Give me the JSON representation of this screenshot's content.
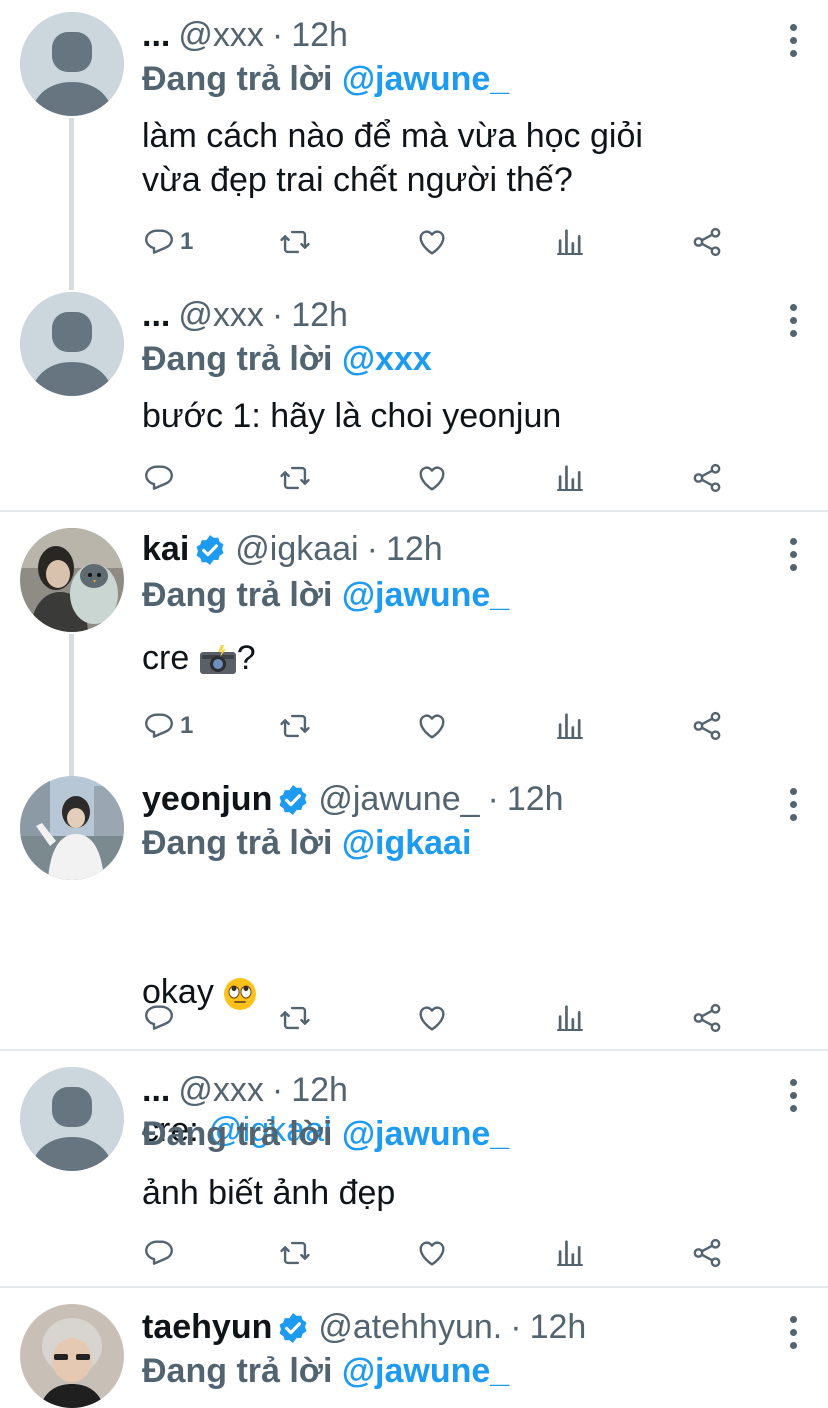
{
  "tweets": [
    {
      "name": "...",
      "handle": "@xxx",
      "time": "12h",
      "replying_prefix": "Đang trả lời",
      "replying_to": "@jawune_",
      "text": "làm cách nào để mà vừa học giỏi\nvừa đẹp trai chết người thế?",
      "reply_count": "1"
    },
    {
      "name": "...",
      "handle": "@xxx",
      "time": "12h",
      "replying_prefix": "Đang trả lời",
      "replying_to": "@xxx",
      "text": "bước 1: hãy là choi yeonjun",
      "reply_count": ""
    },
    {
      "name": "kai",
      "handle": "@igkaai",
      "time": "12h",
      "replying_prefix": "Đang trả lời",
      "replying_to": "@jawune_",
      "text": "cre ",
      "text_end": "?",
      "reply_count": "1"
    },
    {
      "name": "yeonjun",
      "handle": "@jawune_",
      "time": "12h",
      "replying_prefix": "Đang trả lời",
      "replying_to": "@igkaai",
      "text_line1": "okay ",
      "text_line2_prefix": "cre: ",
      "text_line2_mention": "@igkaai",
      "reply_count": ""
    },
    {
      "name": "...",
      "handle": "@xxx",
      "time": "12h",
      "replying_prefix": "Đang trả lời",
      "replying_to": "@jawune_",
      "text": "ảnh biết ảnh đẹp",
      "reply_count": ""
    },
    {
      "name": "taehyun",
      "handle": "@atehhyun.",
      "time": "12h",
      "replying_prefix": "Đang trả lời",
      "replying_to": "@jawune_"
    }
  ],
  "separator_dot": "·",
  "colors": {
    "accent": "#1d9bf0",
    "muted": "#536471",
    "text": "#0f1419"
  }
}
